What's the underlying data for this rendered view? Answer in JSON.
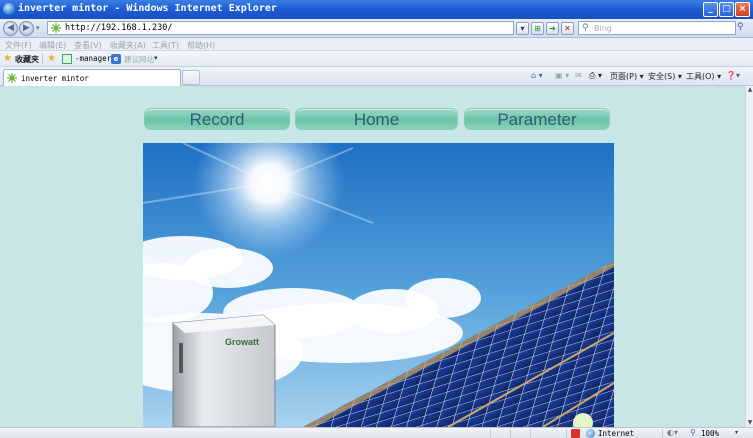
{
  "window": {
    "title": "inverter mintor - Windows Internet Explorer",
    "controls": {
      "minimize": "_",
      "maximize": "□",
      "close": "×"
    }
  },
  "address_bar": {
    "url": "http://192.168.1.230/",
    "search_placeholder": "Bing"
  },
  "menu": [
    "文件(F)",
    "编辑(E)",
    "查看(V)",
    "收藏夹(A)",
    "工具(T)",
    "帮助(H)"
  ],
  "favorites_bar": {
    "label": "收藏夹",
    "link1": "-manager",
    "link2": "建议网站"
  },
  "tab": {
    "label": "inverter mintor"
  },
  "command_bar": {
    "page": "页面(P)",
    "safety": "安全(S)",
    "tools": "工具(O)"
  },
  "page": {
    "nav": [
      {
        "label": "Record"
      },
      {
        "label": "Home"
      },
      {
        "label": "Parameter"
      }
    ],
    "hero": {
      "brand_text": "Growatt"
    }
  },
  "status_bar": {
    "zone": "Internet",
    "zoom": "100%"
  },
  "colors": {
    "page_bg": "#c9e6e6",
    "nav_pill": "#7fcdb4",
    "nav_text": "#2f5b78",
    "titlebar": "#1c5bd6"
  }
}
